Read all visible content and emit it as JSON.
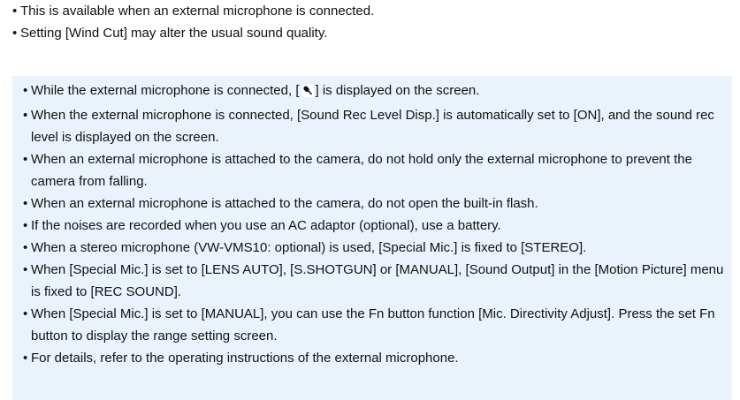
{
  "top_notes": [
    "This is available when an external microphone is connected.",
    "Setting [Wind Cut] may alter the usual sound quality."
  ],
  "note_box": {
    "first_item": {
      "before": "While the external microphone is connected, [",
      "icon": "external-mic-icon",
      "after": "] is displayed on the screen."
    },
    "items": [
      "When the external microphone is connected, [Sound Rec Level Disp.] is automatically set to [ON], and the sound rec level is displayed on the screen.",
      "When an external microphone is attached to the camera, do not hold only the external microphone to prevent the camera from falling.",
      "When an external microphone is attached to the camera, do not open the built-in flash.",
      "If the noises are recorded when you use an AC adaptor (optional), use a battery.",
      "When a stereo microphone (VW-VMS10: optional) is used, [Special Mic.] is fixed to [STEREO].",
      "When [Special Mic.] is set to [LENS AUTO], [S.SHOTGUN] or [MANUAL], [Sound Output] in the [Motion Picture] menu is fixed to [REC SOUND].",
      "When [Special Mic.] is set to [MANUAL], you can use the Fn button function [Mic. Directivity Adjust]. Press the set Fn button to display the range setting screen.",
      "For details, refer to the operating instructions of the external microphone."
    ]
  },
  "bullet_char": "•",
  "colors": {
    "note_background": "#eaf3fb",
    "text": "#111111"
  }
}
